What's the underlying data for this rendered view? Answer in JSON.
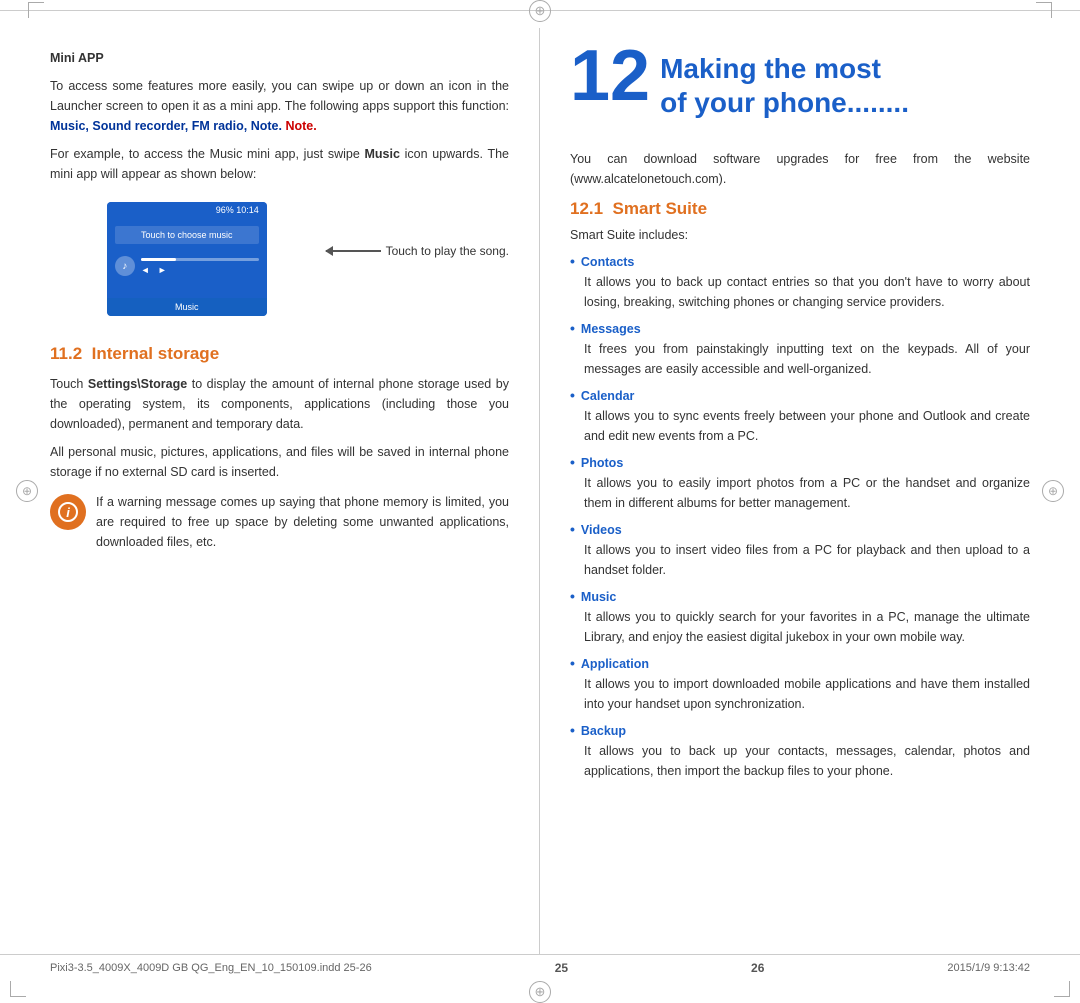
{
  "page": {
    "left": {
      "page_number": "25",
      "mini_app": {
        "title": "Mini APP",
        "para1": "To access some features more easily, you can swipe up or down an icon in the Launcher screen to open it as a mini app. The following apps support this function:",
        "apps_bold": "Music, Sound recorder, FM radio, Note.",
        "para2_prefix": "For example, to access the Music mini app, just swipe ",
        "music_bold": "Music",
        "para2_suffix": " icon upwards. The mini app will appear as shown below:",
        "phone_status": "96%  10:14",
        "phone_touch_label": "Touch to choose music",
        "annotation_text": "Touch to play the song."
      },
      "section_11_2": {
        "number": "11.2",
        "title": "Internal storage",
        "para1_prefix": "Touch ",
        "bold1": "Settings\\Storage",
        "para1_suffix": " to display the amount of internal phone storage used by the operating system, its components, applications (including those you downloaded), permanent and temporary data.",
        "para2": "All personal music, pictures, applications, and files will be saved in internal phone storage if no external SD card is inserted.",
        "warning_text": "If a warning message comes up saying that phone memory is limited, you are required to free up space by deleting some unwanted applications, downloaded files, etc."
      }
    },
    "right": {
      "page_number": "26",
      "chapter": {
        "number": "12",
        "title_line1": "Making the most",
        "title_line2": "of your phone........"
      },
      "intro": "You can download software upgrades for free from the website (www.alcatelonetouch.com).",
      "section_12_1": {
        "number": "12.1",
        "title": "Smart Suite",
        "intro": "Smart Suite includes:",
        "bullets": [
          {
            "title": "Contacts",
            "desc": "It allows you to back up contact entries so that you don't have to worry about losing, breaking, switching phones or changing service providers."
          },
          {
            "title": "Messages",
            "desc": "It frees you from painstakingly inputting text on the keypads. All of your messages are easily accessible and well-organized."
          },
          {
            "title": "Calendar",
            "desc": "It allows you to sync events freely between your phone and Outlook and create and edit new events from a PC."
          },
          {
            "title": "Photos",
            "desc": "It allows you to easily import photos from a PC or the handset and organize them in different albums for better management."
          },
          {
            "title": "Videos",
            "desc": "It allows you to insert video files from a PC for playback and then upload to a handset folder."
          },
          {
            "title": "Music",
            "desc": "It allows you to quickly search for your favorites in a PC, manage the ultimate Library, and enjoy the easiest digital jukebox in your own mobile way."
          },
          {
            "title": "Application",
            "desc": "It allows you to import downloaded mobile applications and have them installed into your handset upon synchronization."
          },
          {
            "title": "Backup",
            "desc": "It allows you to back up your contacts, messages, calendar, photos and applications, then import the backup files to your phone."
          }
        ]
      }
    },
    "footer": {
      "left_text": "Pixi3-3.5_4009X_4009D GB QG_Eng_EN_10_150109.indd  25-26",
      "right_text": "2015/1/9  9:13:42"
    }
  }
}
